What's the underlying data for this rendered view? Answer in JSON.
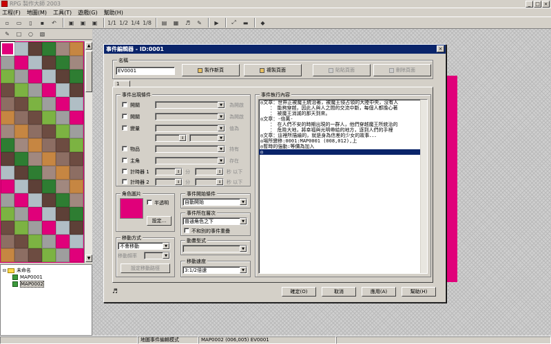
{
  "app": {
    "title": "RPG 製作大師 2003"
  },
  "menu": [
    "工程(F)",
    "地圖(M)",
    "工具(T)",
    "遊戲(G)",
    "幫助(H)"
  ],
  "toolbar": {
    "layer_labels": [
      "1/1",
      "1/2",
      "1/4",
      "1/8"
    ]
  },
  "tree": {
    "root": "未命名",
    "maps": [
      "MAP0001",
      "MAP0002"
    ]
  },
  "statusbar": {
    "mode": "地圖事件編輯模式",
    "location": "MAP0002 (006,005) EV0001"
  },
  "dialog": {
    "title": "事件編輯器 - ID:0001",
    "name_label": "名稱",
    "name_value": "EV0001",
    "new_page": "製作新頁",
    "copy_page": "複製頁面",
    "paste_page": "貼貼頁面",
    "delete_page": "刪除頁面",
    "page_tab": "1",
    "conditions_title": "事件出現條件",
    "cond_switch1": "開關",
    "cond_switch1_suffix": "為開啟",
    "cond_switch2": "開關",
    "cond_switch2_suffix": "為開啟",
    "cond_var": "變量",
    "cond_var_suffix": "值為",
    "cond_item": "物品",
    "cond_item_suffix": "持有",
    "cond_hero": "主角",
    "cond_hero_suffix": "存在",
    "cond_timer1": "計時器 1",
    "cond_timer2": "計時器 2",
    "min_label": "分",
    "sec_label": "秒 以下",
    "graphic_title": "角色圖片",
    "transparent": "半透明",
    "set_button": "設定...",
    "start_title": "事件開始條件",
    "start_value": "自動開始",
    "layer_title": "事件所在層次",
    "layer_value": "普通角色之下",
    "overlap": "不和別的事件重疊",
    "anim_title": "動畫型式",
    "move_title": "移動方式",
    "move_value": "不會移動",
    "freq_label": "移動頻率",
    "route_button": "設定移動路徑",
    "speed_title": "移動速度",
    "speed_value": "3:1/2倍速",
    "commands_title": "事件執行內容",
    "commands": [
      "◎文章：世界正被魔王統治著，被魔王侵占領的大陸中央，沒有人",
      "　　：　能夠穿越，因此人與人之間的交流中斷，每個人都擔心著",
      "　　：　被魔王消滅的那天到來。",
      "◎文章：-倍萬-",
      "　　：　在人們不安的時期出現的一群人，他們穿越魔王所統治的",
      "　　：　危險大地，將幸福與光明帶給的地方，逐到人們的手裡",
      "◎文章：這裡所描繪的，就是身為信差的少女的故事．．．",
      "◎場所變移:0001:MAP0001 (008,012),上",
      "◎暫時的強動:等價為加入",
      "◎"
    ],
    "ok": "確定(O)",
    "cancel": "取消",
    "apply": "應用(A)",
    "help": "幫助(H)"
  },
  "colors": {
    "title_active": "#0a246a",
    "palette_bg": "#e0007a",
    "face": "#d4d0c8"
  }
}
